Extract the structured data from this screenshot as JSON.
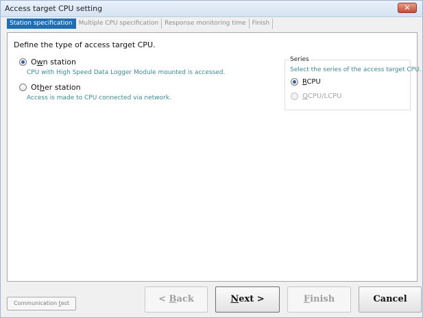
{
  "window": {
    "title": "Access target CPU setting",
    "close_icon": "close-x-icon"
  },
  "tabs": [
    {
      "label": "Station specification",
      "active": true
    },
    {
      "label": "Multiple CPU specification",
      "active": false
    },
    {
      "label": "Response monitoring time",
      "active": false
    },
    {
      "label": "Finish",
      "active": false
    }
  ],
  "main": {
    "prompt": "Define the type of access target CPU.",
    "own_station": {
      "label_pre": "O",
      "label_u": "w",
      "label_post": "n station",
      "desc": "CPU with High Speed Data Logger Module mounted is accessed.",
      "checked": true
    },
    "other_station": {
      "label_pre": "Ot",
      "label_u": "h",
      "label_post": "er station",
      "desc": "Access is made to CPU connected via network.",
      "checked": false
    }
  },
  "series": {
    "title": "Series",
    "desc": "Select the series of the access target CPU.",
    "rcpu": {
      "u": "R",
      "rest": "CPU",
      "checked": true
    },
    "qcpu": {
      "u": "Q",
      "rest": "CPU/LCPU",
      "checked": false,
      "disabled": true
    }
  },
  "buttons": {
    "comm_test_pre": "Communication ",
    "comm_test_u": "t",
    "comm_test_post": "est",
    "back_pre": "< ",
    "back_u": "B",
    "back_post": "ack",
    "next_u": "N",
    "next_post": "ext >",
    "finish_u": "F",
    "finish_post": "inish",
    "cancel": "Cancel"
  },
  "colors": {
    "accent_tab": "#1c6fb6",
    "desc_text": "#3a8b99"
  }
}
